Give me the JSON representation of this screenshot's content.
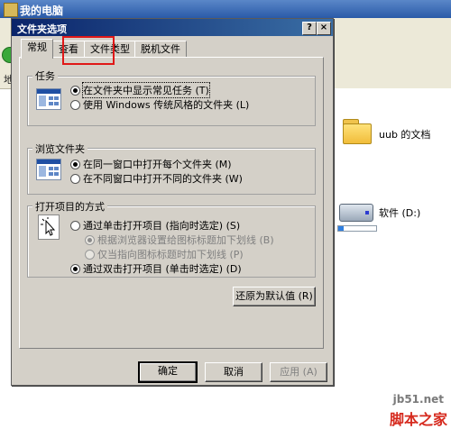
{
  "background_window": {
    "title": "我的电脑",
    "address_label": "地",
    "items": [
      {
        "label": "uub 的文档"
      },
      {
        "label": "软件 (D:)",
        "usage": 0.15
      }
    ]
  },
  "watermark": {
    "site": "jb51.net",
    "name": "脚本之家"
  },
  "dialog": {
    "title": "文件夹选项",
    "help_label": "?",
    "close_label": "×",
    "tabs": [
      {
        "label": "常规",
        "active": true
      },
      {
        "label": "查看",
        "highlighted": true
      },
      {
        "label": "文件类型"
      },
      {
        "label": "脱机文件"
      }
    ],
    "groups": {
      "tasks": {
        "legend": "任务",
        "options": [
          {
            "label": "在文件夹中显示常见任务 (T)",
            "selected": true
          },
          {
            "label": "使用 Windows 传统风格的文件夹 (L)",
            "selected": false
          }
        ]
      },
      "browse": {
        "legend": "浏览文件夹",
        "options": [
          {
            "label": "在同一窗口中打开每个文件夹 (M)",
            "selected": true
          },
          {
            "label": "在不同窗口中打开不同的文件夹 (W)",
            "selected": false
          }
        ]
      },
      "click": {
        "legend": "打开项目的方式",
        "options": [
          {
            "label": "通过单击打开项目 (指向时选定) (S)",
            "selected": false
          },
          {
            "label": "根据浏览器设置给图标标题加下划线 (B)",
            "selected": true,
            "disabled": true
          },
          {
            "label": "仅当指向图标标题时加下划线 (P)",
            "selected": false,
            "disabled": true
          },
          {
            "label": "通过双击打开项目 (单击时选定) (D)",
            "selected": true
          }
        ]
      }
    },
    "restore_defaults_label": "还原为默认值 (R)",
    "buttons": {
      "ok": "确定",
      "cancel": "取消",
      "apply": "应用 (A)"
    }
  }
}
